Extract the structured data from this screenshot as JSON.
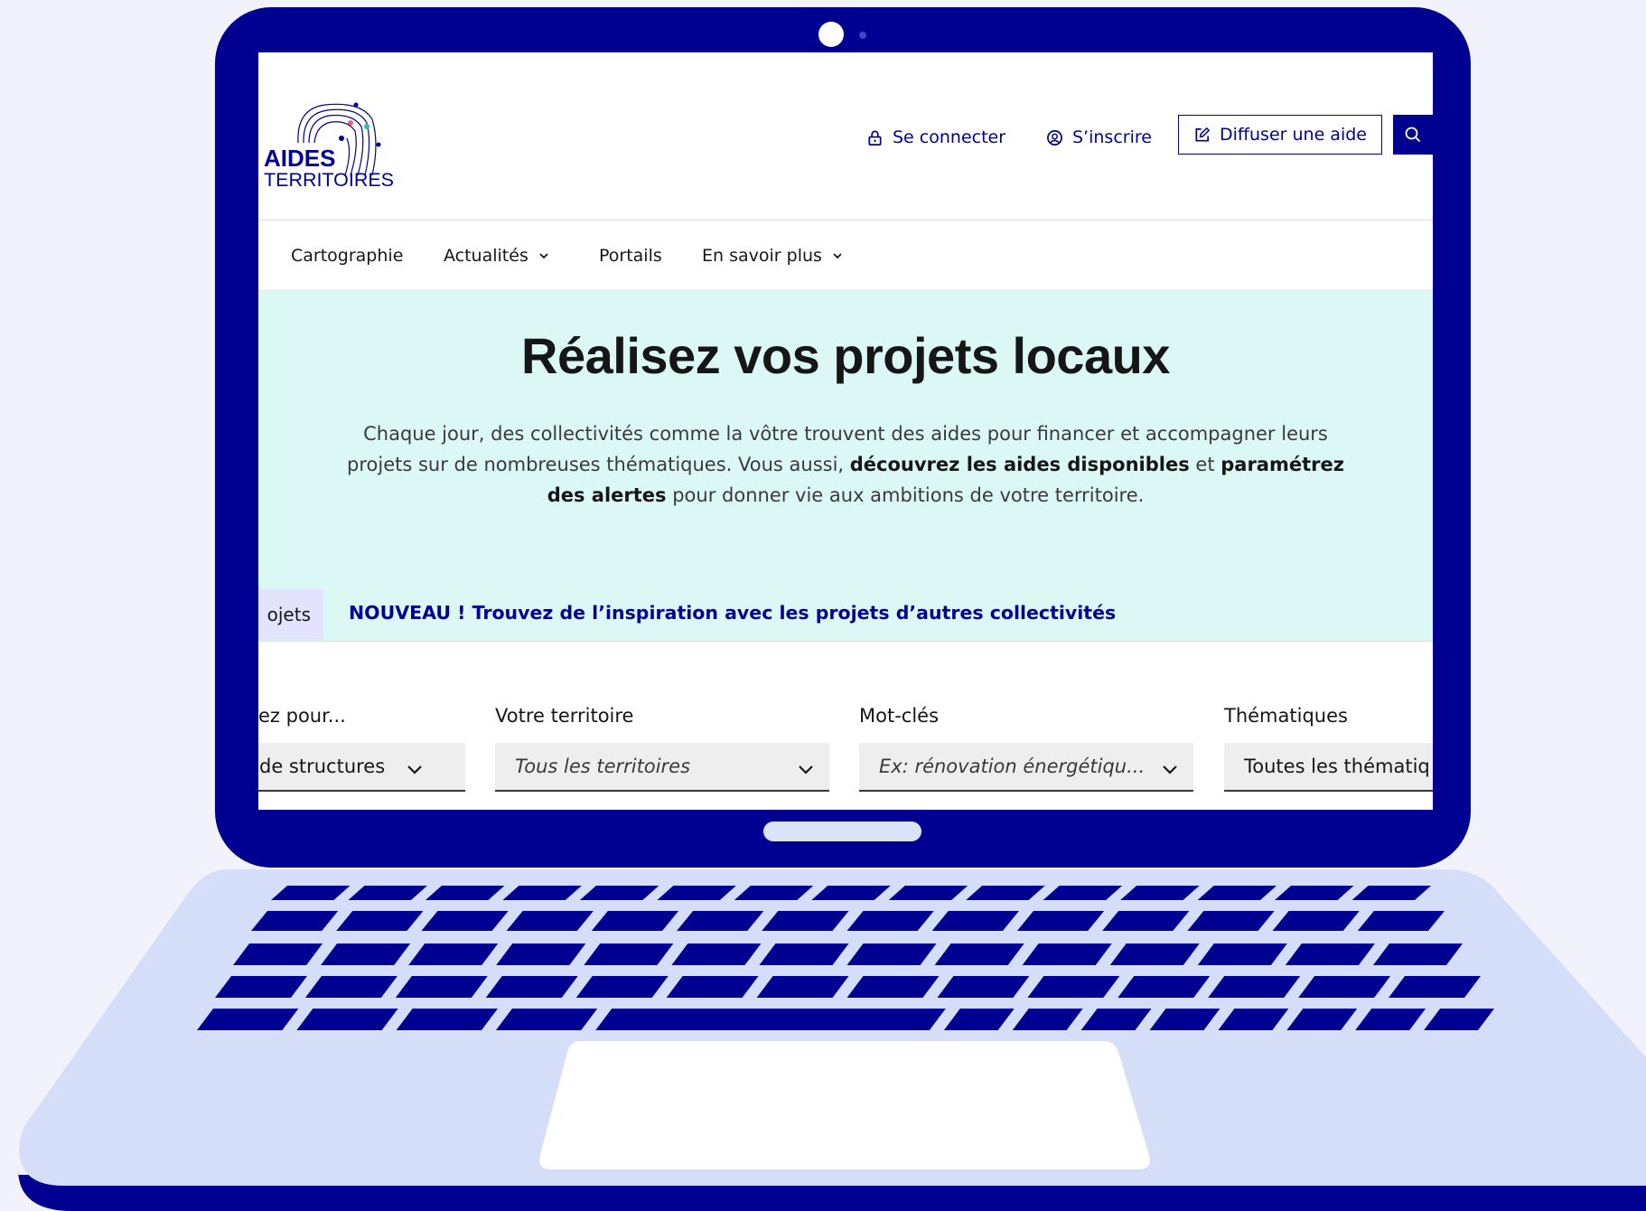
{
  "colors": {
    "laptop_frame": "#000091",
    "laptop_base": "#d5def8",
    "background": "#f1f2fb",
    "hero_background": "#dbf8f4",
    "accent_blue": "#000091",
    "active_tab": "#e3e3fd"
  },
  "logo": {
    "line1": "AIDES",
    "line2": "TERRITOIRES"
  },
  "header": {
    "login": {
      "label": "Se connecter",
      "icon": "lock-icon"
    },
    "signup": {
      "label": "S’inscrire",
      "icon": "user-circle-icon"
    },
    "publish": {
      "label": "Diffuser une aide",
      "icon": "edit-icon"
    },
    "search": {
      "icon": "search-icon"
    }
  },
  "nav": {
    "items": [
      {
        "label": "Cartographie",
        "has_dropdown": false
      },
      {
        "label": "Actualités",
        "has_dropdown": true
      },
      {
        "label": "Portails",
        "has_dropdown": false
      },
      {
        "label": "En savoir plus",
        "has_dropdown": true
      }
    ]
  },
  "hero": {
    "title": "Réalisez vos projets locaux",
    "text_part1": "Chaque jour, des collectivités comme la vôtre trouvent des aides pour financer et accompagner leurs projets sur de nombreuses thématiques. Vous aussi, ",
    "text_bold1": "découvrez les aides disponibles",
    "text_part2": " et ",
    "text_bold2": "paramétrez des alertes",
    "text_part3": " pour donner vie aux ambitions de votre territoire."
  },
  "tabs": {
    "active_label": "ojets",
    "new_label": "NOUVEAU ! Trouvez de l’inspiration avec les projets d’autres collectivités"
  },
  "filters": [
    {
      "label": "ez pour...",
      "value": "de structures",
      "placeholder": false
    },
    {
      "label": "Votre territoire",
      "value": "Tous les territoires",
      "placeholder": true
    },
    {
      "label": "Mot-clés",
      "value": "Ex: rénovation énergétiqu...",
      "placeholder": true
    },
    {
      "label": "Thématiques",
      "value": "Toutes les thématiq",
      "placeholder": false
    }
  ]
}
